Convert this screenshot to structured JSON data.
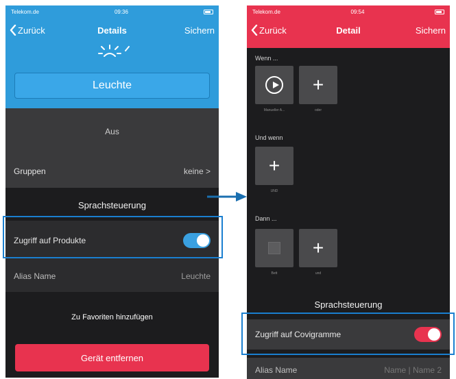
{
  "left_screen": {
    "statusbar": {
      "carrier": "Telekom.de",
      "time": "09:36"
    },
    "nav": {
      "back_label": "Zurück",
      "title": "Details",
      "save_label": "Sichern"
    },
    "lamp_name": "Leuchte",
    "state": "Aus",
    "groups": {
      "label": "Gruppen",
      "value": "keine",
      "chevron": ">"
    },
    "voice_section": "Sprachsteuerung",
    "access_toggle": {
      "label": "Zugriff auf Produkte",
      "on": true
    },
    "alias": {
      "label": "Alias Name",
      "value": "Leuchte"
    },
    "favorites_label": "Zu Favoriten hinzufügen",
    "remove_label": "Gerät entfernen",
    "colors": {
      "header": "#2f9cdb",
      "toggle": "#3aa0e0",
      "remove": "#e8334f"
    }
  },
  "right_screen": {
    "statusbar": {
      "carrier": "Telekom.de",
      "time": "09:54"
    },
    "nav": {
      "back_label": "Zurück",
      "title": "Detail",
      "save_label": "Sichern"
    },
    "when_label": "Wenn ...",
    "when_tiles": [
      {
        "icon": "play-circle-icon",
        "caption": "Manueller A..."
      },
      {
        "icon": "plus-icon",
        "caption": "oder"
      }
    ],
    "and_when_label": "Und wenn",
    "and_when_tiles": [
      {
        "icon": "plus-icon",
        "caption": "UND"
      }
    ],
    "then_label": "Dann ...",
    "then_tiles": [
      {
        "icon": "lamp-icon",
        "caption": "Bett"
      },
      {
        "icon": "plus-icon",
        "caption": "und"
      }
    ],
    "voice_section": "Sprachsteuerung",
    "access_toggle": {
      "label": "Zugriff auf Covigramme",
      "on": true
    },
    "alias": {
      "label": "Alias Name",
      "value": "Name | Name 2"
    },
    "colors": {
      "header": "#e8334f",
      "toggle": "#e8334f"
    }
  },
  "arrow_color": "#1a6fb0",
  "highlight_color": "#1a7fd0"
}
